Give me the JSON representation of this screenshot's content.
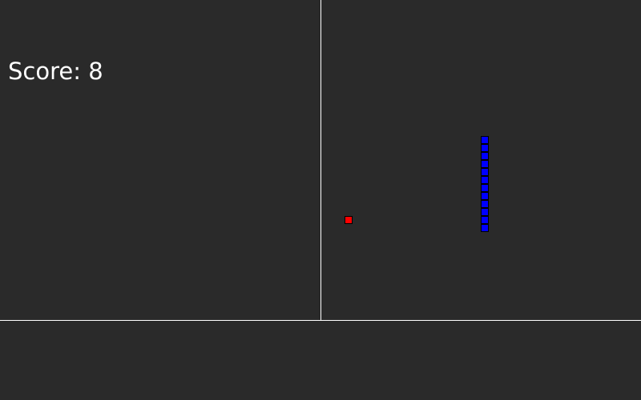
{
  "score_panel": {
    "label": "Score: ",
    "value": "8"
  },
  "board": {
    "columns": 40,
    "rows": 40,
    "background_color": "#2a2a2a",
    "divider_color": "#ffffff"
  },
  "food": {
    "col": 3,
    "row": 27,
    "color": "#ff0000"
  },
  "snake": {
    "color": "#0000ff",
    "segments": [
      {
        "col": 20,
        "row": 17
      },
      {
        "col": 20,
        "row": 18
      },
      {
        "col": 20,
        "row": 19
      },
      {
        "col": 20,
        "row": 20
      },
      {
        "col": 20,
        "row": 21
      },
      {
        "col": 20,
        "row": 22
      },
      {
        "col": 20,
        "row": 23
      },
      {
        "col": 20,
        "row": 24
      },
      {
        "col": 20,
        "row": 25
      },
      {
        "col": 20,
        "row": 26
      },
      {
        "col": 20,
        "row": 27
      },
      {
        "col": 20,
        "row": 28
      }
    ]
  }
}
